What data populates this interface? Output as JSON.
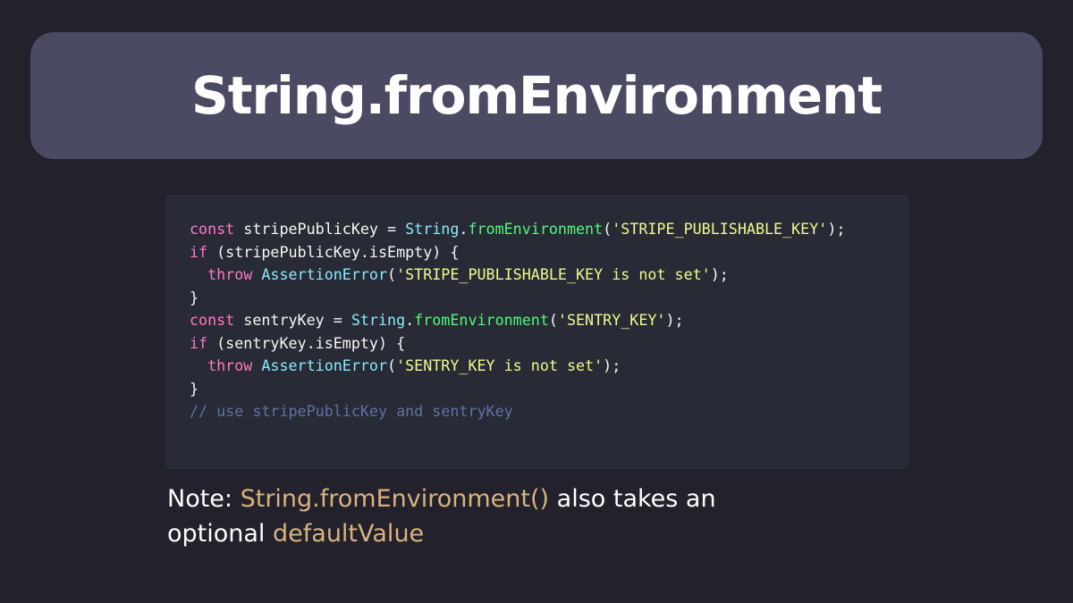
{
  "title": "String.fromEnvironment",
  "colors": {
    "background": "#22212c",
    "banner": "#4a4b63",
    "code_background": "#282a36",
    "keyword": "#ff79c6",
    "class": "#8be9fd",
    "function": "#50fa7b",
    "string": "#f1fa8c",
    "comment": "#6272a4",
    "highlight": "#d8b37f"
  },
  "code": {
    "lines": [
      [
        {
          "t": "const",
          "k": "kw"
        },
        {
          "t": " stripePublicKey = ",
          "k": "plain"
        },
        {
          "t": "String",
          "k": "cls"
        },
        {
          "t": ".",
          "k": "plain"
        },
        {
          "t": "fromEnvironment",
          "k": "fn"
        },
        {
          "t": "(",
          "k": "plain"
        },
        {
          "t": "'STRIPE_PUBLISHABLE_KEY'",
          "k": "str"
        },
        {
          "t": ");",
          "k": "plain"
        }
      ],
      [
        {
          "t": "if",
          "k": "kw"
        },
        {
          "t": " (stripePublicKey.isEmpty) {",
          "k": "plain"
        }
      ],
      [
        {
          "t": "  ",
          "k": "plain"
        },
        {
          "t": "throw",
          "k": "kw"
        },
        {
          "t": " ",
          "k": "plain"
        },
        {
          "t": "AssertionError",
          "k": "cls"
        },
        {
          "t": "(",
          "k": "plain"
        },
        {
          "t": "'STRIPE_PUBLISHABLE_KEY is not set'",
          "k": "str"
        },
        {
          "t": ");",
          "k": "plain"
        }
      ],
      [
        {
          "t": "}",
          "k": "plain"
        }
      ],
      [
        {
          "t": "const",
          "k": "kw"
        },
        {
          "t": " sentryKey = ",
          "k": "plain"
        },
        {
          "t": "String",
          "k": "cls"
        },
        {
          "t": ".",
          "k": "plain"
        },
        {
          "t": "fromEnvironment",
          "k": "fn"
        },
        {
          "t": "(",
          "k": "plain"
        },
        {
          "t": "'SENTRY_KEY'",
          "k": "str"
        },
        {
          "t": ");",
          "k": "plain"
        }
      ],
      [
        {
          "t": "if",
          "k": "kw"
        },
        {
          "t": " (sentryKey.isEmpty) {",
          "k": "plain"
        }
      ],
      [
        {
          "t": "  ",
          "k": "plain"
        },
        {
          "t": "throw",
          "k": "kw"
        },
        {
          "t": " ",
          "k": "plain"
        },
        {
          "t": "AssertionError",
          "k": "cls"
        },
        {
          "t": "(",
          "k": "plain"
        },
        {
          "t": "'SENTRY_KEY is not set'",
          "k": "str"
        },
        {
          "t": ");",
          "k": "plain"
        }
      ],
      [
        {
          "t": "}",
          "k": "plain"
        }
      ],
      [
        {
          "t": "// use stripePublicKey and sentryKey",
          "k": "cmt"
        }
      ]
    ]
  },
  "note": {
    "prefix": "Note: ",
    "highlight1": "String.fromEnvironment()",
    "middle": " also takes an optional ",
    "highlight2": "defaultValue"
  }
}
